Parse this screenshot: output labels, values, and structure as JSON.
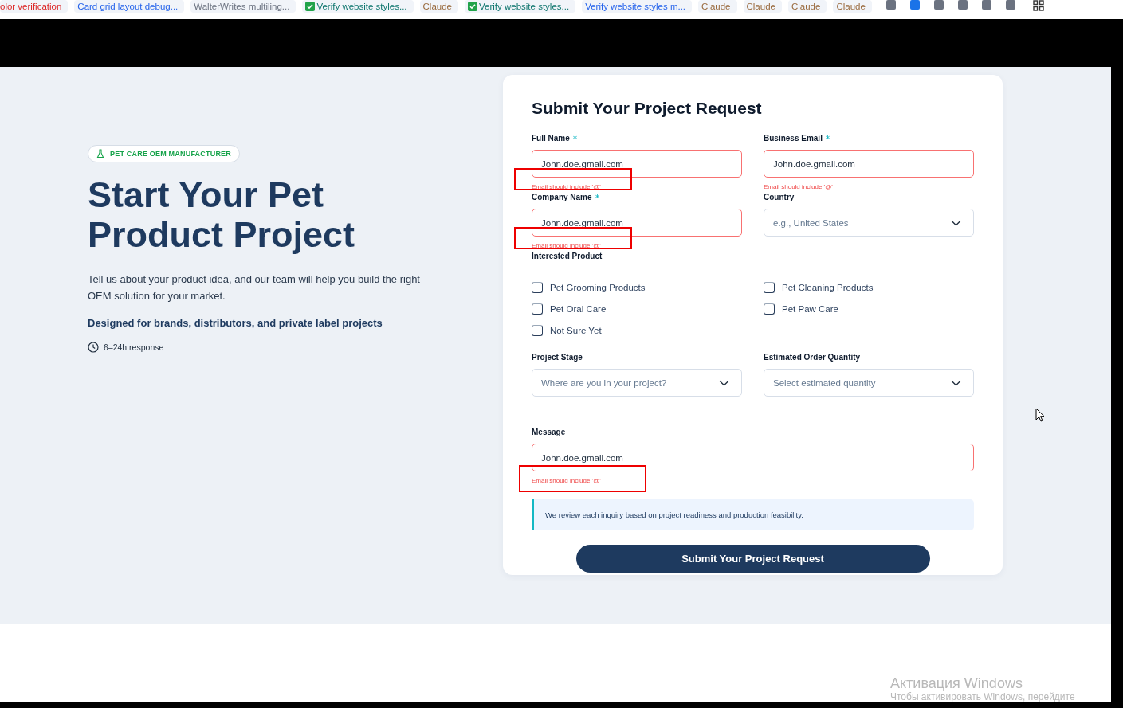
{
  "bookmarks": [
    {
      "label": "olor verification",
      "color": "#dc2626",
      "checked": false
    },
    {
      "label": "Card grid layout debug...",
      "color": "#2563eb",
      "checked": false
    },
    {
      "label": "WalterWrites multiling...",
      "color": "#6b7280",
      "checked": false
    },
    {
      "label": "Verify website styles...",
      "color": "#0f766e",
      "checked": true
    },
    {
      "label": "Claude",
      "color": "#9a6b3f",
      "checked": false
    },
    {
      "label": "Verify website styles...",
      "color": "#0f766e",
      "checked": true
    },
    {
      "label": "Verify website styles m...",
      "color": "#2563eb",
      "checked": false
    },
    {
      "label": "Claude",
      "color": "#9a6b3f",
      "checked": false
    },
    {
      "label": "Claude",
      "color": "#9a6b3f",
      "checked": false
    },
    {
      "label": "Claude",
      "color": "#9a6b3f",
      "checked": false
    },
    {
      "label": "Claude",
      "color": "#9a6b3f",
      "checked": false
    }
  ],
  "toolbar_squares": [
    {
      "color": "#6b7280"
    },
    {
      "color": "#1a73e8"
    },
    {
      "color": "#6b7280"
    },
    {
      "color": "#6b7280"
    },
    {
      "color": "#6b7280"
    },
    {
      "color": "#6b7280"
    }
  ],
  "hero": {
    "badge": "PET CARE OEM MANUFACTURER",
    "title": "Start Your Pet Product Project",
    "intro": "Tell us about your product idea, and our team will help you build the right OEM solution for your market.",
    "tagline": "Designed for brands, distributors, and private label projects",
    "response": "6–24h response"
  },
  "form": {
    "title": "Submit Your Project Request",
    "sections": [
      {
        "kind": "fields",
        "fields": [
          {
            "label": "Full Name",
            "required": true,
            "kind": "text",
            "value": "John.doe.gmail.com",
            "error": {
              "text": "Email should include '@'",
              "annotated": true
            }
          },
          {
            "label": "Business Email",
            "required": true,
            "kind": "text",
            "value": "John.doe.gmail.com",
            "error": {
              "text": "Email should include '@'",
              "annotated": false
            }
          },
          {
            "label": "Company Name",
            "required": true,
            "kind": "text",
            "value": "John.doe.gmail.com",
            "error": {
              "text": "Email should include '@'",
              "annotated": true
            }
          },
          {
            "label": "Country",
            "required": false,
            "kind": "select",
            "placeholder": "e.g., United States"
          }
        ]
      },
      {
        "kind": "checkboxes",
        "label": "Interested Product",
        "options": [
          {
            "label": "Pet Grooming Products",
            "checked": false
          },
          {
            "label": "Pet Cleaning Products",
            "checked": false
          },
          {
            "label": "Pet Oral Care",
            "checked": false
          },
          {
            "label": "Pet Paw Care",
            "checked": false
          },
          {
            "label": "Not Sure Yet",
            "checked": false
          }
        ]
      },
      {
        "kind": "fields",
        "fields": [
          {
            "label": "Project Stage",
            "required": false,
            "kind": "select",
            "placeholder": "Where are you in your project?"
          },
          {
            "label": "Estimated Order Quantity",
            "required": false,
            "kind": "select",
            "placeholder": "Select estimated quantity"
          },
          {
            "label": "Message",
            "required": false,
            "kind": "text",
            "wide": true,
            "value": "John.doe.gmail.com",
            "error": {
              "text": "Email should include '@'",
              "annotated": true
            }
          }
        ]
      }
    ],
    "note": "We review each inquiry based on project readiness and production feasibility.",
    "submit": "Submit Your Project Request"
  },
  "os_notice": {
    "title": "Активация Windows",
    "text": "Чтобы активировать Windows, перейдите"
  }
}
